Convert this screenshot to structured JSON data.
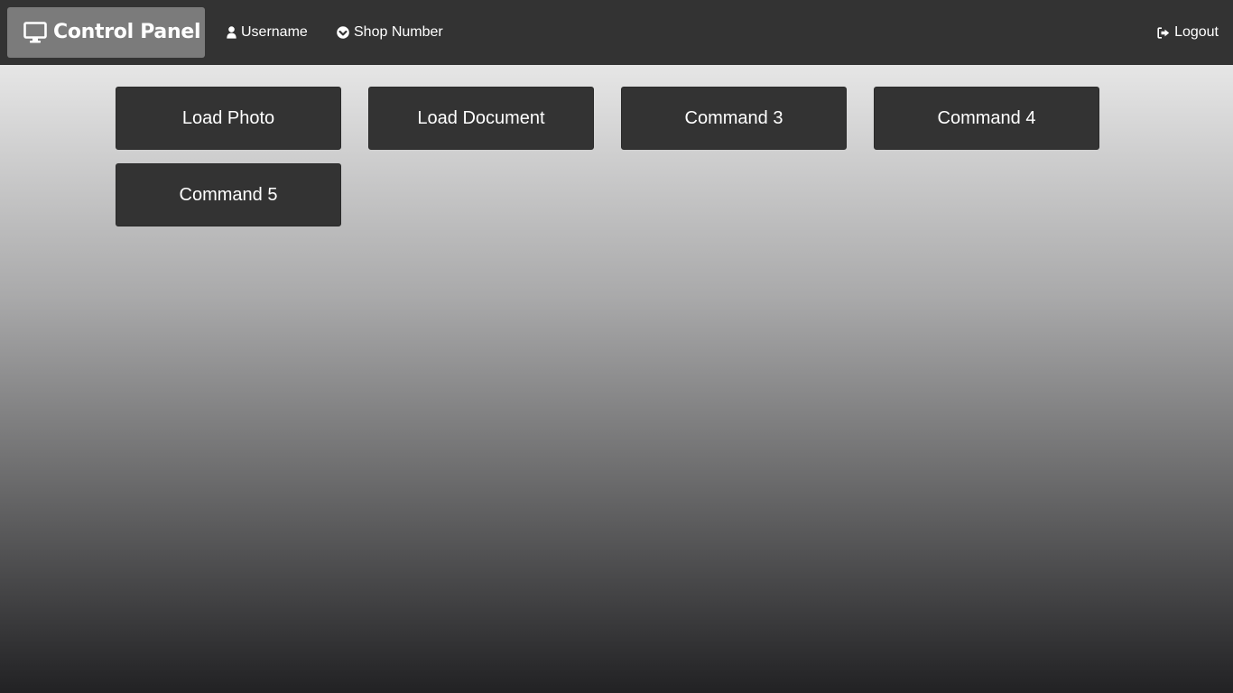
{
  "navbar": {
    "brand": {
      "label": "Control Panel",
      "icon": "desktop-monitor-icon"
    },
    "links": {
      "username": {
        "label": "Username",
        "icon": "user-icon"
      },
      "shop_number": {
        "label": "Shop Number",
        "icon": "check-circle-icon"
      },
      "logout": {
        "label": "Logout",
        "icon": "sign-out-icon"
      }
    }
  },
  "commands": [
    {
      "label": "Load Photo"
    },
    {
      "label": "Load Document"
    },
    {
      "label": "Command 3"
    },
    {
      "label": "Command 4"
    },
    {
      "label": "Command 5"
    }
  ],
  "colors": {
    "navbar_bg": "#333333",
    "brand_bg": "#7b7b7b",
    "button_bg": "#333333",
    "text": "#ffffff"
  }
}
